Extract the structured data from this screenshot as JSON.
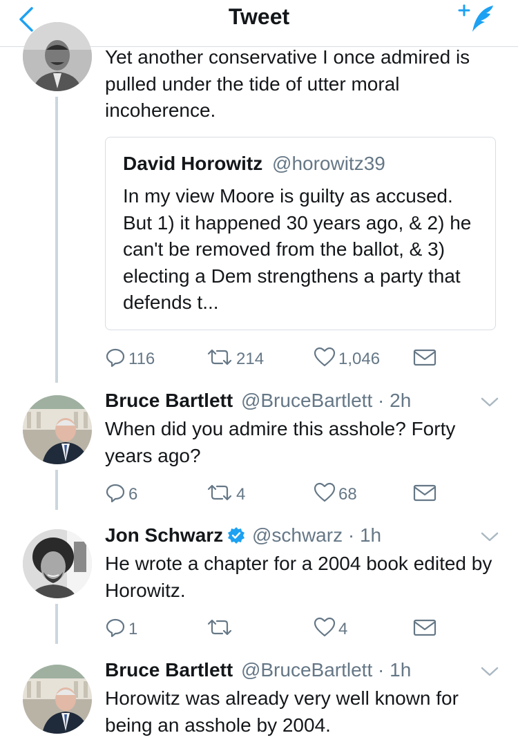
{
  "nav": {
    "title": "Tweet"
  },
  "colors": {
    "accent": "#1da1f2",
    "icon_gray": "#657786",
    "thread_line": "#ccd6dd"
  },
  "main_tweet": {
    "text": "Yet another conservative I once admired is pulled under the tide of utter moral incoherence.",
    "quoted": {
      "name": "David Horowitz",
      "handle": "@horowitz39",
      "text": "In my view Moore is guilty as accused. But 1) it happened 30 years ago, & 2) he can't be removed from the ballot, & 3) electing a Dem strengthens a party that defends t..."
    },
    "replies": "116",
    "retweets": "214",
    "likes": "1,046"
  },
  "replies": [
    {
      "name": "Bruce Bartlett",
      "handle": "@BruceBartlett",
      "time": "2h",
      "verified": false,
      "text": "When did you admire this asshole? Forty years ago?",
      "replies": "6",
      "retweets": "4",
      "likes": "68"
    },
    {
      "name": "Jon Schwarz",
      "handle": "@schwarz",
      "time": "1h",
      "verified": true,
      "text": "He wrote a chapter for a 2004 book edited by Horowitz.",
      "replies": "1",
      "retweets": "",
      "likes": "4"
    },
    {
      "name": "Bruce Bartlett",
      "handle": "@BruceBartlett",
      "time": "1h",
      "verified": false,
      "text": "Horowitz was already very well known for being an asshole by 2004."
    }
  ],
  "icons": [
    "back-chevron-icon",
    "compose-tweet-icon",
    "reply-icon",
    "retweet-icon",
    "like-icon",
    "direct-message-icon",
    "verified-badge-icon",
    "caret-down-icon"
  ]
}
